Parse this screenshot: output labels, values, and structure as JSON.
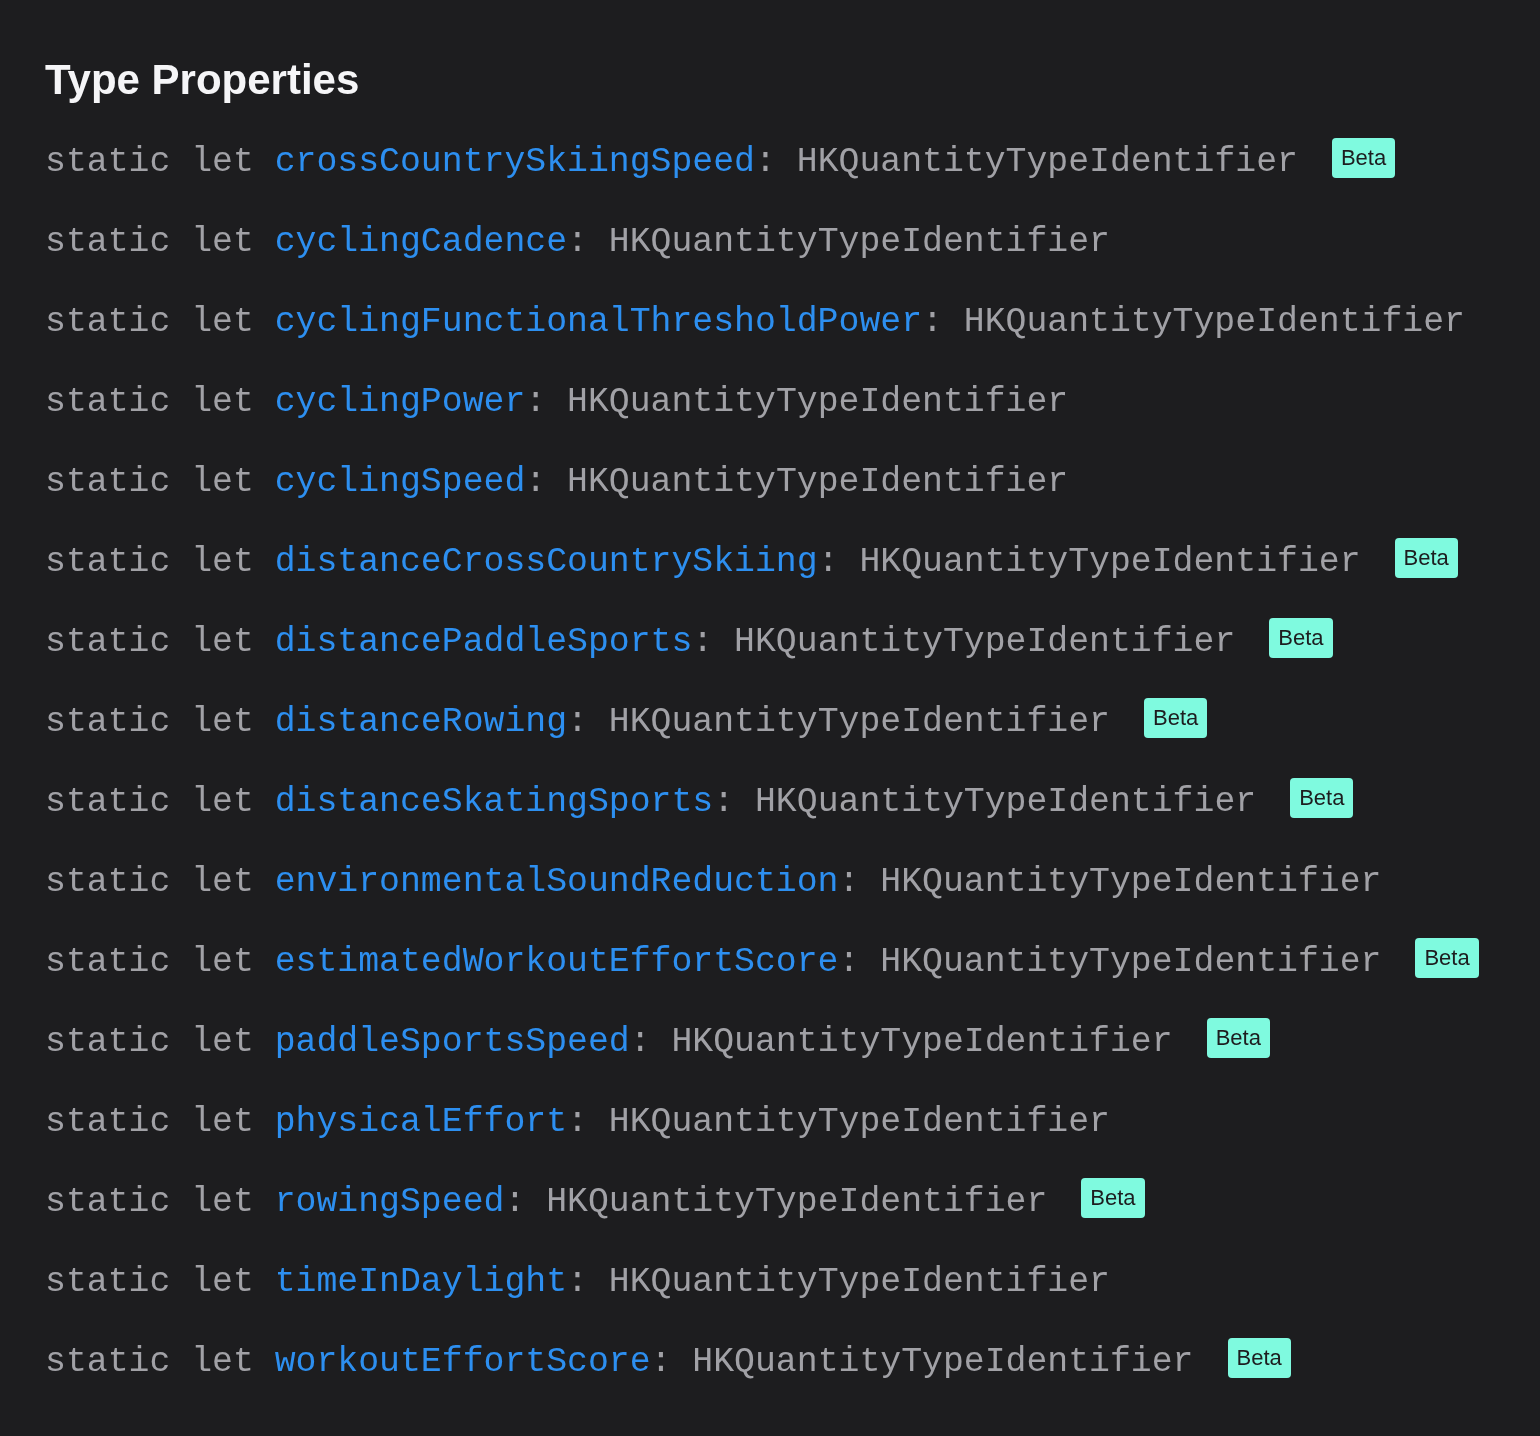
{
  "section": {
    "title": "Type Properties"
  },
  "properties": [
    {
      "keyword": "static let",
      "name": "crossCountrySkiingSpeed",
      "separator": ":",
      "type": "HKQuantityTypeIdentifier",
      "badge": "Beta"
    },
    {
      "keyword": "static let",
      "name": "cyclingCadence",
      "separator": ":",
      "type": "HKQuantityTypeIdentifier"
    },
    {
      "keyword": "static let",
      "name": "cyclingFunctionalThresholdPower",
      "separator": ":",
      "type": "HKQuantityTypeIdentifier"
    },
    {
      "keyword": "static let",
      "name": "cyclingPower",
      "separator": ":",
      "type": "HKQuantityTypeIdentifier"
    },
    {
      "keyword": "static let",
      "name": "cyclingSpeed",
      "separator": ":",
      "type": "HKQuantityTypeIdentifier"
    },
    {
      "keyword": "static let",
      "name": "distanceCrossCountrySkiing",
      "separator": ":",
      "type": "HKQuantityTypeIdentifier",
      "badge": "Beta"
    },
    {
      "keyword": "static let",
      "name": "distancePaddleSports",
      "separator": ":",
      "type": "HKQuantityTypeIdentifier",
      "badge": "Beta"
    },
    {
      "keyword": "static let",
      "name": "distanceRowing",
      "separator": ":",
      "type": "HKQuantityTypeIdentifier",
      "badge": "Beta"
    },
    {
      "keyword": "static let",
      "name": "distanceSkatingSports",
      "separator": ":",
      "type": "HKQuantityTypeIdentifier",
      "badge": "Beta"
    },
    {
      "keyword": "static let",
      "name": "environmentalSoundReduction",
      "separator": ":",
      "type": "HKQuantityTypeIdentifier"
    },
    {
      "keyword": "static let",
      "name": "estimatedWorkoutEffortScore",
      "separator": ":",
      "type": "HKQuantityTypeIdentifier",
      "badge": "Beta"
    },
    {
      "keyword": "static let",
      "name": "paddleSportsSpeed",
      "separator": ":",
      "type": "HKQuantityTypeIdentifier",
      "badge": "Beta"
    },
    {
      "keyword": "static let",
      "name": "physicalEffort",
      "separator": ":",
      "type": "HKQuantityTypeIdentifier"
    },
    {
      "keyword": "static let",
      "name": "rowingSpeed",
      "separator": ":",
      "type": "HKQuantityTypeIdentifier",
      "badge": "Beta"
    },
    {
      "keyword": "static let",
      "name": "timeInDaylight",
      "separator": ":",
      "type": "HKQuantityTypeIdentifier"
    },
    {
      "keyword": "static let",
      "name": "workoutEffortScore",
      "separator": ":",
      "type": "HKQuantityTypeIdentifier",
      "badge": "Beta"
    }
  ]
}
